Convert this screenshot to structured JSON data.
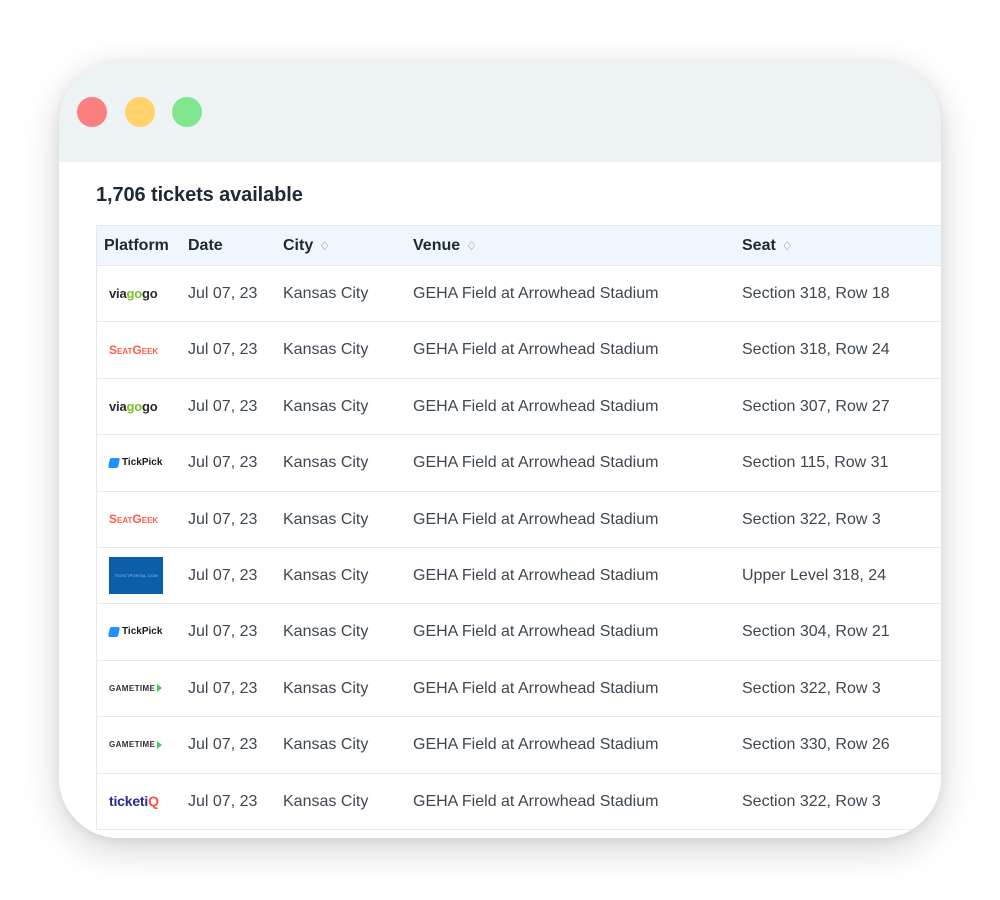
{
  "window": {
    "controls": [
      {
        "name": "close",
        "color": "#fb7f7f"
      },
      {
        "name": "minimize",
        "color": "#ffd26b"
      },
      {
        "name": "maximize",
        "color": "#7fe58f"
      }
    ]
  },
  "main": {
    "heading": "1,706 tickets available"
  },
  "table": {
    "columns": [
      {
        "label": "Platform",
        "sortable": false
      },
      {
        "label": "Date",
        "sortable": false
      },
      {
        "label": "City",
        "sortable": true
      },
      {
        "label": "Venue",
        "sortable": true
      },
      {
        "label": "Seat",
        "sortable": true
      }
    ],
    "sort_glyph": "♢",
    "rows": [
      {
        "platform": "viagogo",
        "date": "Jul 07, 23",
        "city": "Kansas City",
        "venue": "GEHA Field at Arrowhead Stadium",
        "seat": "Section 318, Row 18"
      },
      {
        "platform": "seatgeek",
        "date": "Jul 07, 23",
        "city": "Kansas City",
        "venue": "GEHA Field at Arrowhead Stadium",
        "seat": "Section 318, Row 24"
      },
      {
        "platform": "viagogo",
        "date": "Jul 07, 23",
        "city": "Kansas City",
        "venue": "GEHA Field at Arrowhead Stadium",
        "seat": "Section 307, Row 27"
      },
      {
        "platform": "tickpick",
        "date": "Jul 07, 23",
        "city": "Kansas City",
        "venue": "GEHA Field at Arrowhead Stadium",
        "seat": "Section 115, Row 31"
      },
      {
        "platform": "seatgeek",
        "date": "Jul 07, 23",
        "city": "Kansas City",
        "venue": "GEHA Field at Arrowhead Stadium",
        "seat": "Section 322, Row 3"
      },
      {
        "platform": "blue-box",
        "date": "Jul 07, 23",
        "city": "Kansas City",
        "venue": "GEHA Field at Arrowhead Stadium",
        "seat": "Upper Level 318, 24"
      },
      {
        "platform": "tickpick",
        "date": "Jul 07, 23",
        "city": "Kansas City",
        "venue": "GEHA Field at Arrowhead Stadium",
        "seat": "Section 304, Row 21"
      },
      {
        "platform": "gametime",
        "date": "Jul 07, 23",
        "city": "Kansas City",
        "venue": "GEHA Field at Arrowhead Stadium",
        "seat": "Section 322, Row 3"
      },
      {
        "platform": "gametime",
        "date": "Jul 07, 23",
        "city": "Kansas City",
        "venue": "GEHA Field at Arrowhead Stadium",
        "seat": "Section 330, Row 26"
      },
      {
        "platform": "ticketiq",
        "date": "Jul 07, 23",
        "city": "Kansas City",
        "venue": "GEHA Field at Arrowhead Stadium",
        "seat": "Section 322, Row 3"
      }
    ]
  },
  "logos": {
    "viagogo": {
      "pre": "via",
      "mid": "go",
      "post": "go"
    },
    "seatgeek": {
      "text": "SeatGeek"
    },
    "tickpick": {
      "text": "TickPick"
    },
    "blue-box": {
      "text": "TICKETPORTAL.COM"
    },
    "gametime": {
      "text": "GAMETIME"
    },
    "ticketiq": {
      "pre": "ticketi",
      "post": "Q"
    }
  }
}
